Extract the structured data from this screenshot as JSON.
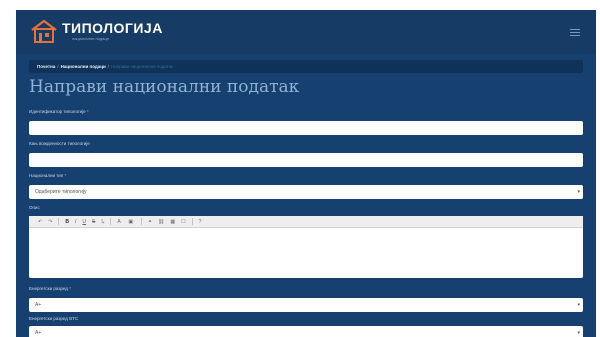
{
  "header": {
    "brand": "ТИПОЛОГИЈА",
    "tagline": "национални подаци"
  },
  "breadcrumb": {
    "home": "Почетна",
    "section": "Национални подаци",
    "current": "Направи национални податак",
    "separator": "/"
  },
  "page": {
    "title": "Направи национални податак"
  },
  "form": {
    "identifier": {
      "label": "Идентификатор типологије",
      "required": "*",
      "value": ""
    },
    "older_id": {
      "label": "Кањ вожденности типологије",
      "value": ""
    },
    "national_type": {
      "label": "Национални тип",
      "required": "*",
      "value": "Одаберите типологију",
      "caret": "▾"
    },
    "description": {
      "label": "Опис",
      "toolbar": [
        "↶",
        "↷",
        "B",
        "I",
        "U",
        "S",
        "Iₓ",
        "A·",
        "▣·",
        "⚭",
        "⛓",
        "▦",
        "☐",
        "?"
      ]
    },
    "energy_class": {
      "label": "Енергетски разред",
      "required": "*",
      "value": "A+",
      "caret": "▾"
    },
    "energy_class_btc": {
      "label": "Енергетски разред BTC",
      "value": "A+",
      "caret": "▾"
    }
  }
}
